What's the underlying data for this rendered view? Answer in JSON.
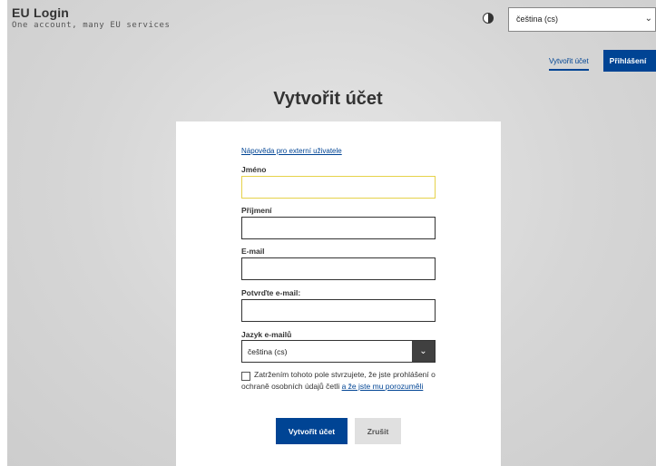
{
  "header": {
    "brand_title": "EU Login",
    "brand_subtitle": "One account, many EU services",
    "contrast_icon": "contrast-icon",
    "language_selected": "čeština (cs)",
    "nav_create": "Vytvořit účet",
    "nav_login": "Přihlášení"
  },
  "page": {
    "title": "Vytvořit účet"
  },
  "form": {
    "help_link": "Nápověda pro externí uživatele",
    "first_name_label": "Jméno",
    "first_name_value": "",
    "last_name_label": "Příjmení",
    "last_name_value": "",
    "email_label": "E-mail",
    "email_value": "",
    "confirm_email_label": "Potvrďte e-mail:",
    "confirm_email_value": "",
    "email_language_label": "Jazyk e-mailů",
    "email_language_selected": "čeština (cs)",
    "consent_text_1": "Zatržením tohoto pole stvrzujete, že jste ",
    "consent_text_2": "prohlášení o ochraně osobních údajů",
    "consent_text_3": " četli ",
    "consent_link": "a že jste mu porozuměli",
    "create_button": "Vytvořit účet",
    "cancel_button": "Zrušit"
  },
  "colors": {
    "primary": "#004494",
    "focus": "#e6d24a",
    "dark_button": "#404040"
  }
}
